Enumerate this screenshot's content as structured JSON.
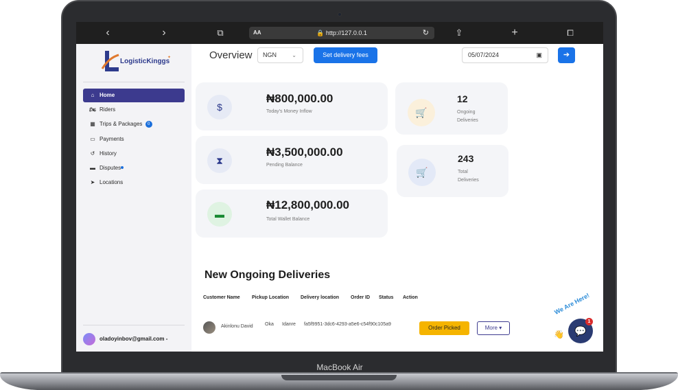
{
  "device": {
    "brand": "MacBook Air"
  },
  "browser": {
    "text_size_label": "AA",
    "url": "http://127.0.0.1",
    "back_icon": "chevron-left",
    "forward_icon": "chevron-right",
    "reader_icon": "book",
    "reload_icon": "reload",
    "share_icon": "share",
    "new_tab_icon": "plus",
    "tabs_icon": "tabs"
  },
  "sidebar": {
    "logo_text": "LogisticKinggs",
    "items": [
      {
        "label": "Home",
        "icon": "home-icon",
        "active": true
      },
      {
        "label": "Riders",
        "icon": "rider-icon"
      },
      {
        "label": "Trips & Packages",
        "icon": "package-icon",
        "badge": "0"
      },
      {
        "label": "Payments",
        "icon": "payment-icon"
      },
      {
        "label": "History",
        "icon": "history-icon"
      },
      {
        "label": "Disputes",
        "icon": "dispute-icon",
        "dot": true
      },
      {
        "label": "Locations",
        "icon": "location-icon"
      }
    ],
    "user_email": "oladoyinbov@gmail.com -"
  },
  "header": {
    "title": "Overview",
    "currency_value": "NGN",
    "fees_button": "Set delivery fees",
    "date_value": "05/07/2024",
    "go_icon": "arrow-right"
  },
  "stats": {
    "money_inflow": {
      "amount": "₦800,000.00",
      "label": "Today's Money Inflow",
      "icon": "money-hand-icon"
    },
    "pending_balance": {
      "amount": "₦3,500,000.00",
      "label": "Pending Balance",
      "icon": "hourglass-icon"
    },
    "wallet_balance": {
      "amount": "₦12,800,000.00",
      "label": "Total Wallet Balance",
      "icon": "wallet-icon"
    },
    "ongoing": {
      "count": "12",
      "label_line1": "Ongoing",
      "label_line2": "Deliveries",
      "icon": "cart-icon"
    },
    "total": {
      "count": "243",
      "label_line1": "Total",
      "label_line2": "Deliveries",
      "icon": "cart-icon"
    }
  },
  "deliveries": {
    "title": "New Ongoing Deliveries",
    "columns": [
      "Customer Name",
      "Pickup Location",
      "Delivery location",
      "Order ID",
      "Status",
      "Action"
    ],
    "rows": [
      {
        "customer": "Akinlonu David",
        "pickup": "Oka",
        "delivery": "Idanre",
        "order_id": "fa5f9951-3dc6-4293-a5e6-c54f90c105a9",
        "status": "Order Picked",
        "action": "More ▾"
      }
    ]
  },
  "chat": {
    "tag": "We Are Here!",
    "badge": "1"
  },
  "colors": {
    "primary": "#1a73e8",
    "sidebar_active": "#3c3a8e",
    "status_picked": "#f5b400"
  }
}
